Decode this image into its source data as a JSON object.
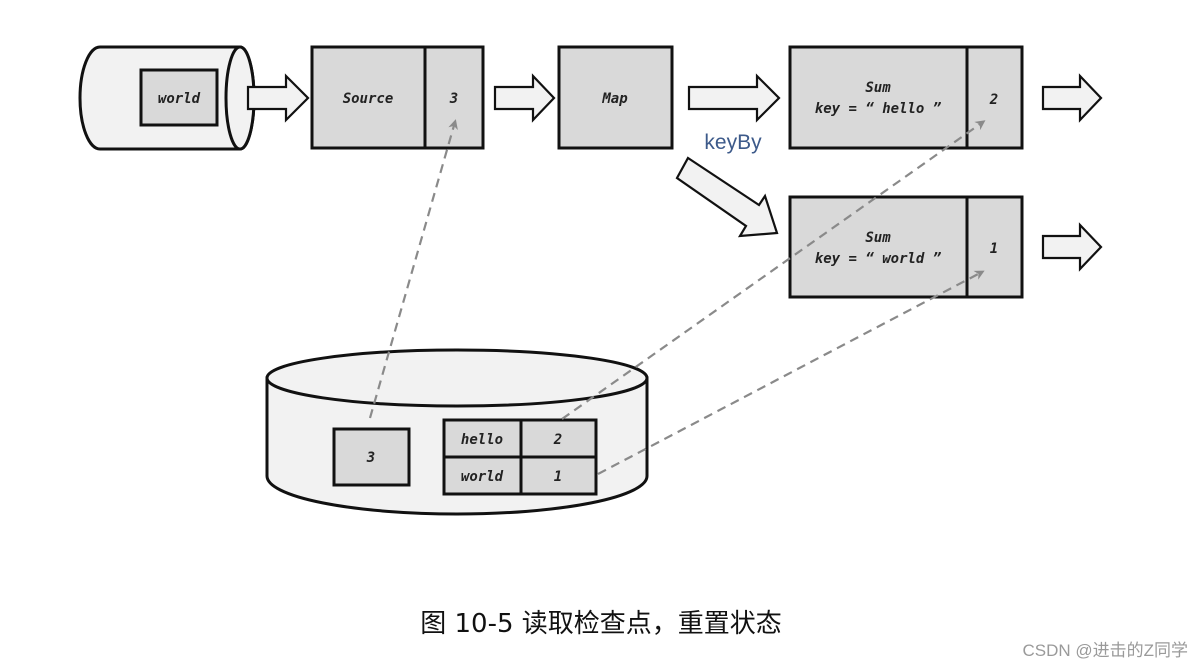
{
  "diagram": {
    "source_queue": {
      "item": "world"
    },
    "source_operator": {
      "label": "Source",
      "offset": "3"
    },
    "map_operator": {
      "label": "Map"
    },
    "edge_label": "keyBy",
    "sum_hello": {
      "title": "Sum",
      "key": "key = “ hello ”",
      "count": "2"
    },
    "sum_world": {
      "title": "Sum",
      "key": "key = “ world ”",
      "count": "1"
    },
    "checkpoint_store": {
      "offset": "3",
      "state_table": [
        {
          "key": "hello",
          "value": "2"
        },
        {
          "key": "world",
          "value": "1"
        }
      ]
    }
  },
  "caption": "图 10-5  读取检查点，重置状态",
  "watermark": "CSDN @进击的Z同学"
}
